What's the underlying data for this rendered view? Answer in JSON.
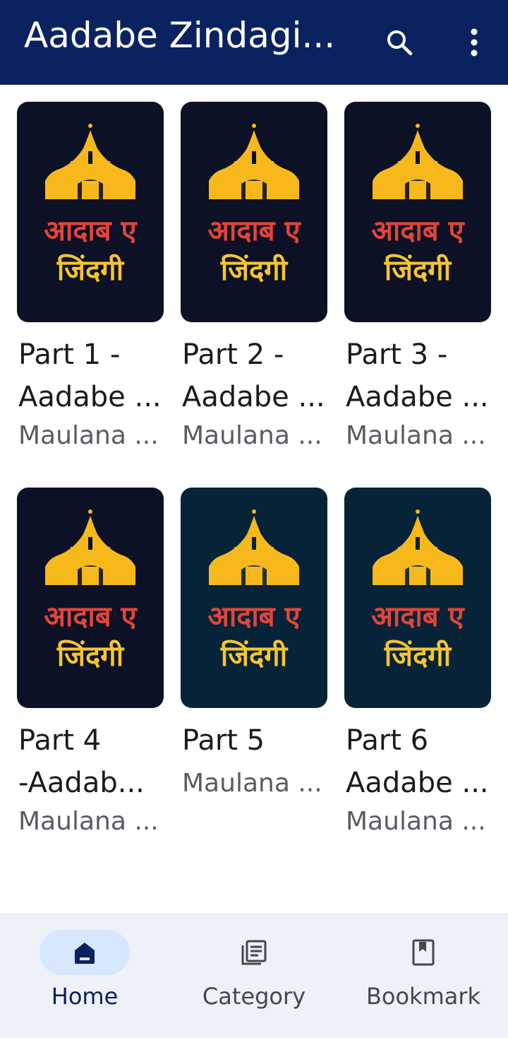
{
  "appbar": {
    "title": "Aadabe Zindagi...",
    "search_icon": "search-icon",
    "menu_icon": "more-vert-icon"
  },
  "cover": {
    "title_line1": "आदाब ए",
    "title_line2": "जिंदगी"
  },
  "books": [
    {
      "title_line1": "Part 1 -",
      "title_line2": "Aadabe ...",
      "author": "Maulana ...",
      "theme": "dark"
    },
    {
      "title_line1": "Part 2 -",
      "title_line2": "Aadabe ...",
      "author": "Maulana ...",
      "theme": "dark"
    },
    {
      "title_line1": "Part 3 -",
      "title_line2": "Aadabe ...",
      "author": "Maulana ...",
      "theme": "dark"
    },
    {
      "title_line1": "Part 4",
      "title_line2": "-Aadab...",
      "author": "Maulana ...",
      "theme": "dark"
    },
    {
      "title_line1": "Part 5",
      "title_line2": "",
      "author": "Maulana ...",
      "theme": "teal"
    },
    {
      "title_line1": "Part 6",
      "title_line2": "Aadabe ...",
      "author": "Maulana ...",
      "theme": "teal"
    }
  ],
  "bottom_nav": {
    "items": [
      {
        "label": "Home",
        "icon": "home-icon",
        "active": true
      },
      {
        "label": "Category",
        "icon": "article-icon",
        "active": false
      },
      {
        "label": "Bookmark",
        "icon": "bookmark-icon",
        "active": false
      }
    ]
  },
  "colors": {
    "appbar_bg": "#0b2260",
    "cover_dark": "#0d1126",
    "cover_teal": "#062338",
    "dome_gold": "#f7b81c",
    "text_red": "#e0463a",
    "text_yellow": "#f5c531",
    "nav_active_pill": "#d6e7ff"
  }
}
